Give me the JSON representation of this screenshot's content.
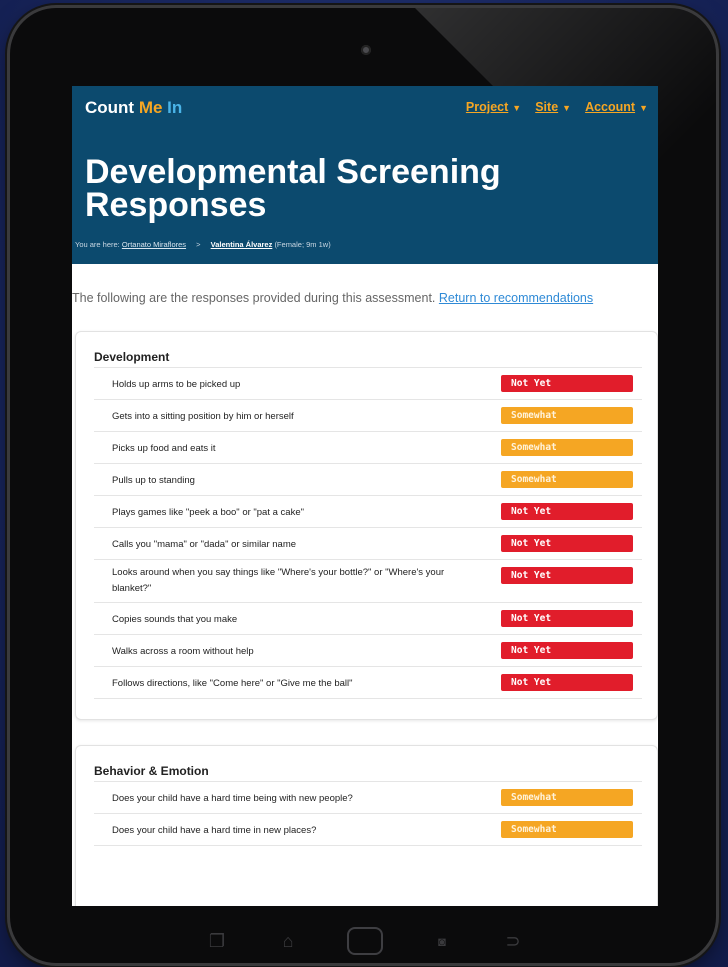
{
  "app": {
    "brand_parts": [
      "Count ",
      "Me",
      " In"
    ],
    "nav": [
      {
        "label": "Project"
      },
      {
        "label": "Site"
      },
      {
        "label": "Account"
      }
    ]
  },
  "page": {
    "title": "Developmental Screening Responses",
    "breadcrumb": {
      "prefix": "You are here:",
      "site": "Ortanato Miraflores",
      "separator": ">",
      "child": "Valentina Álvarez",
      "child_meta": "(Female; 9m 1w)"
    },
    "intro": "The following are the responses provided during this assessment.",
    "return_link": "Return to recommendations"
  },
  "sections": [
    {
      "title": "Development",
      "items": [
        {
          "question": "Holds up arms to be picked up",
          "response": "Not Yet"
        },
        {
          "question": "Gets into a sitting position by him or herself",
          "response": "Somewhat"
        },
        {
          "question": "Picks up food and eats it",
          "response": "Somewhat"
        },
        {
          "question": "Pulls up to standing",
          "response": "Somewhat"
        },
        {
          "question": "Plays games like \"peek a boo\" or \"pat a cake\"",
          "response": "Not Yet"
        },
        {
          "question": "Calls you \"mama\" or \"dada\" or similar name",
          "response": "Not Yet"
        },
        {
          "question": "Looks around when you say things like \"Where's your bottle?\" or \"Where's your blanket?\"",
          "response": "Not Yet"
        },
        {
          "question": "Copies sounds that you make",
          "response": "Not Yet"
        },
        {
          "question": "Walks across a room without help",
          "response": "Not Yet"
        },
        {
          "question": "Follows directions, like \"Come here\" or \"Give me the ball\"",
          "response": "Not Yet"
        }
      ]
    },
    {
      "title": "Behavior & Emotion",
      "items": [
        {
          "question": "Does your child have a hard time being with new people?",
          "response": "Somewhat"
        },
        {
          "question": "Does your child have a hard time in new places?",
          "response": "Somewhat"
        }
      ]
    }
  ],
  "colors": {
    "header_bg": "#0c4a6e",
    "brand_accent_orange": "#f6a623",
    "brand_accent_blue": "#4ab4e8",
    "not_yet": "#e11d2b",
    "somewhat": "#f5a623",
    "link": "#2f8ad6"
  },
  "icons": {
    "nav_dropdown": "caret-down-icon",
    "device_softkeys": [
      "recent-apps-icon",
      "home-icon",
      "home-button",
      "camera-icon",
      "back-icon"
    ]
  }
}
